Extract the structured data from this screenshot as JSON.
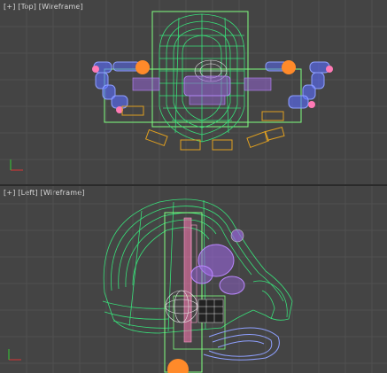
{
  "viewports": [
    {
      "id": "top",
      "menu_plus": "[+]",
      "view_name": "[Top]",
      "shading": "[Wireframe]"
    },
    {
      "id": "left",
      "menu_plus": "[+]",
      "view_name": "[Left]",
      "shading": "[Wireframe]"
    }
  ],
  "colors": {
    "background": "#444444",
    "grid": "#505050",
    "grid_major": "#5a5a5a",
    "helmet_wire": "#39e07a",
    "selection_box": "#7fff7f",
    "visor": "#9966dd",
    "arm_blue": "#5a6cff",
    "joint_orange": "#ff8a2a",
    "pad_outline": "#e0a020",
    "pink_frame": "#ff7ab5",
    "white_mesh": "#e8e8e8",
    "axis_x": "#dd3333",
    "axis_y": "#33cc33"
  }
}
